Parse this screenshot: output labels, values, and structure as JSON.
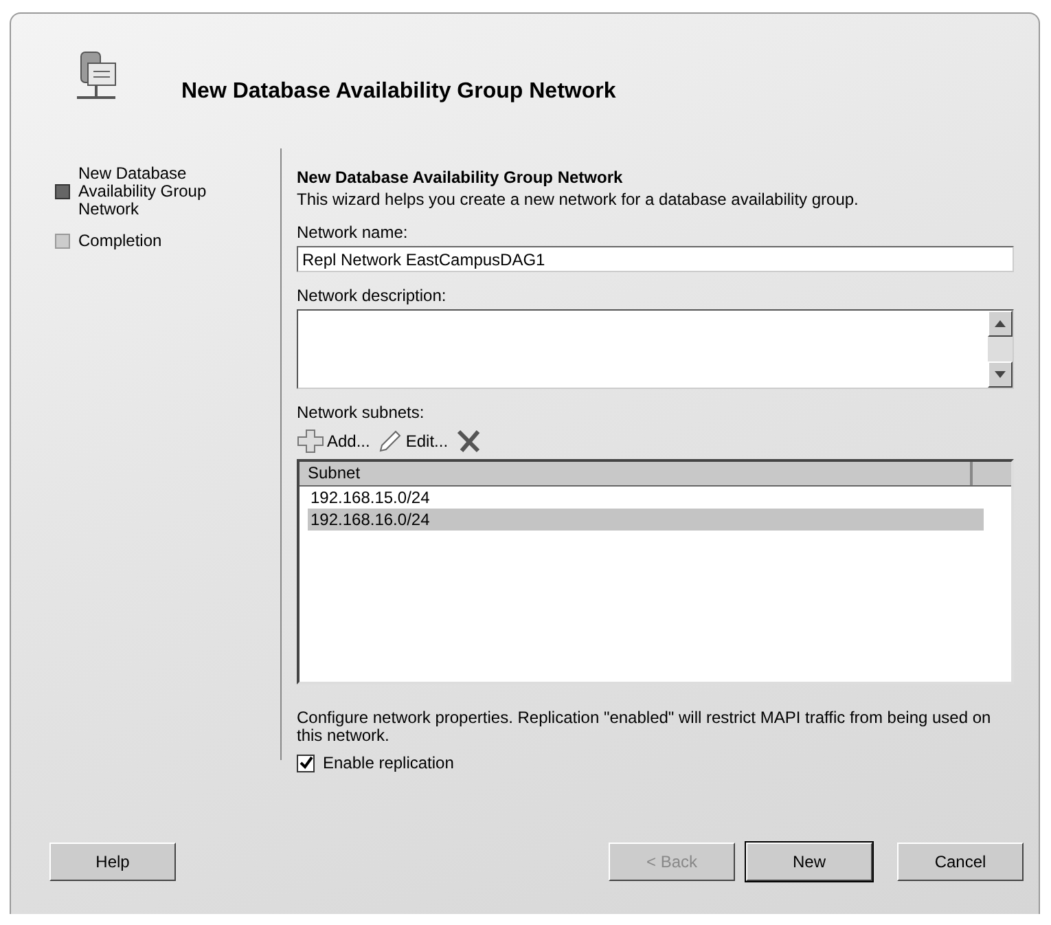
{
  "header": {
    "title": "New Database Availability Group Network"
  },
  "steps": [
    {
      "label": "New Database Availability Group Network",
      "selected": true
    },
    {
      "label": "Completion",
      "selected": false
    }
  ],
  "page": {
    "heading": "New Database Availability Group Network",
    "intro": "This wizard helps you create a new network for a database availability group.",
    "name_label": "Network name:",
    "name_value": "Repl Network EastCampusDAG1",
    "description_label": "Network description:",
    "subnets_label": "Network subnets:",
    "toolbar": [
      {
        "kind": "add",
        "label": "Add..."
      },
      {
        "kind": "edit",
        "label": "Edit..."
      },
      {
        "kind": "remove"
      }
    ],
    "table": {
      "columns": [
        "Subnet"
      ],
      "rows": [
        {
          "subnet": "192.168.15.0/24",
          "selected": false
        },
        {
          "subnet": "192.168.16.0/24",
          "selected": true
        }
      ]
    },
    "note": "Configure network properties. Replication \"enabled\" will restrict MAPI traffic from being used on this network.",
    "replication": {
      "label": "Enable replication",
      "checked": true
    }
  },
  "buttons": [
    {
      "kind": "help",
      "label": "Help",
      "disabled": false
    },
    {
      "kind": "back",
      "label": "< Back",
      "disabled": true
    },
    {
      "kind": "default",
      "label": "New",
      "disabled": false
    },
    {
      "kind": "cancel",
      "label": "Cancel",
      "disabled": false
    }
  ]
}
